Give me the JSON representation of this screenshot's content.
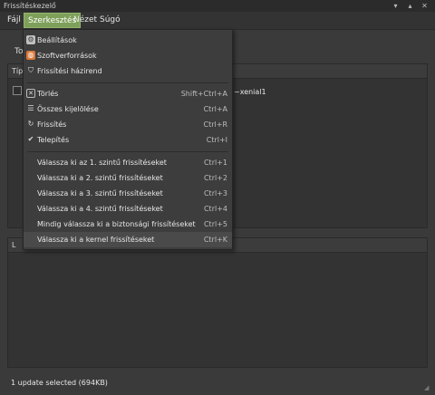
{
  "window": {
    "title": "Frissítéskezelő"
  },
  "menubar": {
    "file": "Fájl",
    "edit": "Szerkesztés",
    "view": "Nézet",
    "help": "Súgó"
  },
  "toolbar": {
    "text": "To"
  },
  "list": {
    "column_header": "Típ",
    "row_tail": "~xenial1"
  },
  "lower_panel": {
    "header": "L"
  },
  "status": {
    "text": "1 update selected (694KB)"
  },
  "edit_menu": {
    "items": [
      {
        "label": "Beállítások",
        "accel": "",
        "icon": "settings-icon"
      },
      {
        "label": "Szoftverforrások",
        "accel": "",
        "icon": "software-sources-icon"
      },
      {
        "label": "Frissítési házirend",
        "accel": "",
        "icon": "shield-icon"
      },
      {
        "label": "Törlés",
        "accel": "Shift+Ctrl+A",
        "icon": "clear-icon"
      },
      {
        "label": "Összes kijelölése",
        "accel": "Ctrl+A",
        "icon": "select-all-icon"
      },
      {
        "label": "Frissítés",
        "accel": "Ctrl+R",
        "icon": "refresh-icon"
      },
      {
        "label": "Telepítés",
        "accel": "Ctrl+I",
        "icon": "install-icon"
      },
      {
        "label": "Válassza ki az 1. szintű frissítéseket",
        "accel": "Ctrl+1",
        "icon": ""
      },
      {
        "label": "Válassza ki a 2. szintű frissítéseket",
        "accel": "Ctrl+2",
        "icon": ""
      },
      {
        "label": "Válassza ki a 3. szintű frissítéseket",
        "accel": "Ctrl+3",
        "icon": ""
      },
      {
        "label": "Válassza ki a 4. szintű frissítéseket",
        "accel": "Ctrl+4",
        "icon": ""
      },
      {
        "label": "Mindig válassza ki a biztonsági frissítéseket",
        "accel": "Ctrl+5",
        "icon": ""
      },
      {
        "label": "Válassza ki a kernel frissítéseket",
        "accel": "Ctrl+K",
        "icon": ""
      }
    ]
  },
  "colors": {
    "accent": "#7ea05a",
    "background": "#3a3a3a"
  }
}
